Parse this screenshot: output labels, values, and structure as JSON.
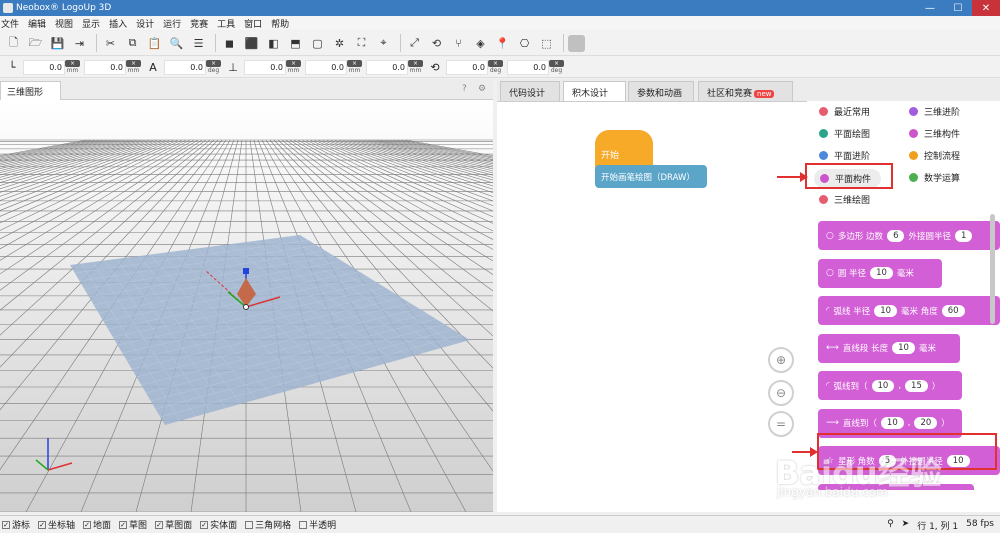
{
  "window": {
    "title": "Neobox® LogoUp 3D",
    "controls": [
      "—",
      "☐",
      "✕"
    ]
  },
  "menu": [
    "文件",
    "编辑",
    "视图",
    "显示",
    "插入",
    "设计",
    "运行",
    "竞赛",
    "工具",
    "窗口",
    "帮助"
  ],
  "toolbar_icons": [
    "new-file-icon",
    "open-folder-icon",
    "save-icon",
    "export-icon",
    "cut-icon",
    "copy-icon",
    "paste-icon",
    "search-icon",
    "list-icon",
    "cube-icon",
    "cube-front-icon",
    "cube-side-icon",
    "cube-top-icon",
    "wire-cube-icon",
    "gear-cube-icon",
    "frame-icon",
    "axis-icon",
    "expand-icon",
    "rotate-axis-icon",
    "split-axis-icon",
    "fill-icon",
    "pin-icon",
    "camera-icon",
    "package-icon",
    "stop-icon"
  ],
  "coords": {
    "values": [
      "0.0",
      "0.0",
      "0.0",
      "0.0",
      "0.0",
      "0.0",
      "0.0",
      "0.0"
    ],
    "unit_mm": "mm",
    "unit_deg": "deg"
  },
  "left_panel": {
    "tab": "三维图形",
    "help": "?",
    "settings": "⚙"
  },
  "right_tabs": [
    "代码设计",
    "积木设计",
    "参数和动画",
    "社区和竞赛"
  ],
  "new_badge": "new",
  "workspace": {
    "hat": "开始",
    "draw": "开始画笔绘图（DRAW）"
  },
  "categories": [
    {
      "label": "最近常用",
      "color": "#e85c6f"
    },
    {
      "label": "三维进阶",
      "color": "#a15ce0"
    },
    {
      "label": "平面绘图",
      "color": "#2aa58c"
    },
    {
      "label": "三维构件",
      "color": "#cc55cc"
    },
    {
      "label": "平面进阶",
      "color": "#4a8ad8"
    },
    {
      "label": "控制流程",
      "color": "#f0a020"
    },
    {
      "label": "平面构件",
      "color": "#cc55cc"
    },
    {
      "label": "数学运算",
      "color": "#4caf50"
    },
    {
      "label": "三维绘图",
      "color": "#e85c6f"
    }
  ],
  "blocks": [
    {
      "icon": "○",
      "parts": [
        "多边形 边数",
        "6",
        "外接圆半径",
        "1"
      ]
    },
    {
      "icon": "○",
      "parts": [
        "圆 半径",
        "10",
        "毫米"
      ]
    },
    {
      "icon": "◜",
      "parts": [
        "弧线 半径",
        "10",
        "毫米 角度",
        "60"
      ]
    },
    {
      "icon": "⟷",
      "parts": [
        "直线段 长度",
        "10",
        "毫米"
      ]
    },
    {
      "icon": "◜",
      "parts": [
        "弧线到（",
        "10",
        ",",
        "15",
        "）"
      ]
    },
    {
      "icon": "⟶",
      "parts": [
        "直线到（",
        "10",
        ",",
        "20",
        "）"
      ]
    },
    {
      "icon": "☆",
      "parts": [
        "星形 角数",
        "5",
        "外接圆半径",
        "10"
      ]
    },
    {
      "icon": "☆",
      "parts": [
        "五角星 外接圆半径",
        "10",
        "毫米"
      ]
    }
  ],
  "zoom": [
    "⊕",
    "⊖",
    "="
  ],
  "statusbar": {
    "checks": [
      {
        "label": "游标",
        "checked": true
      },
      {
        "label": "坐标轴",
        "checked": true
      },
      {
        "label": "地面",
        "checked": true
      },
      {
        "label": "草图",
        "checked": true
      },
      {
        "label": "草图面",
        "checked": true
      },
      {
        "label": "实体面",
        "checked": true
      },
      {
        "label": "三角网格",
        "checked": false
      },
      {
        "label": "半透明",
        "checked": false
      }
    ],
    "position": "行 1, 列 1",
    "fps": "58 fps"
  },
  "watermark": {
    "text": "Baidu经验",
    "sub": "jingyan.baidu.com"
  }
}
